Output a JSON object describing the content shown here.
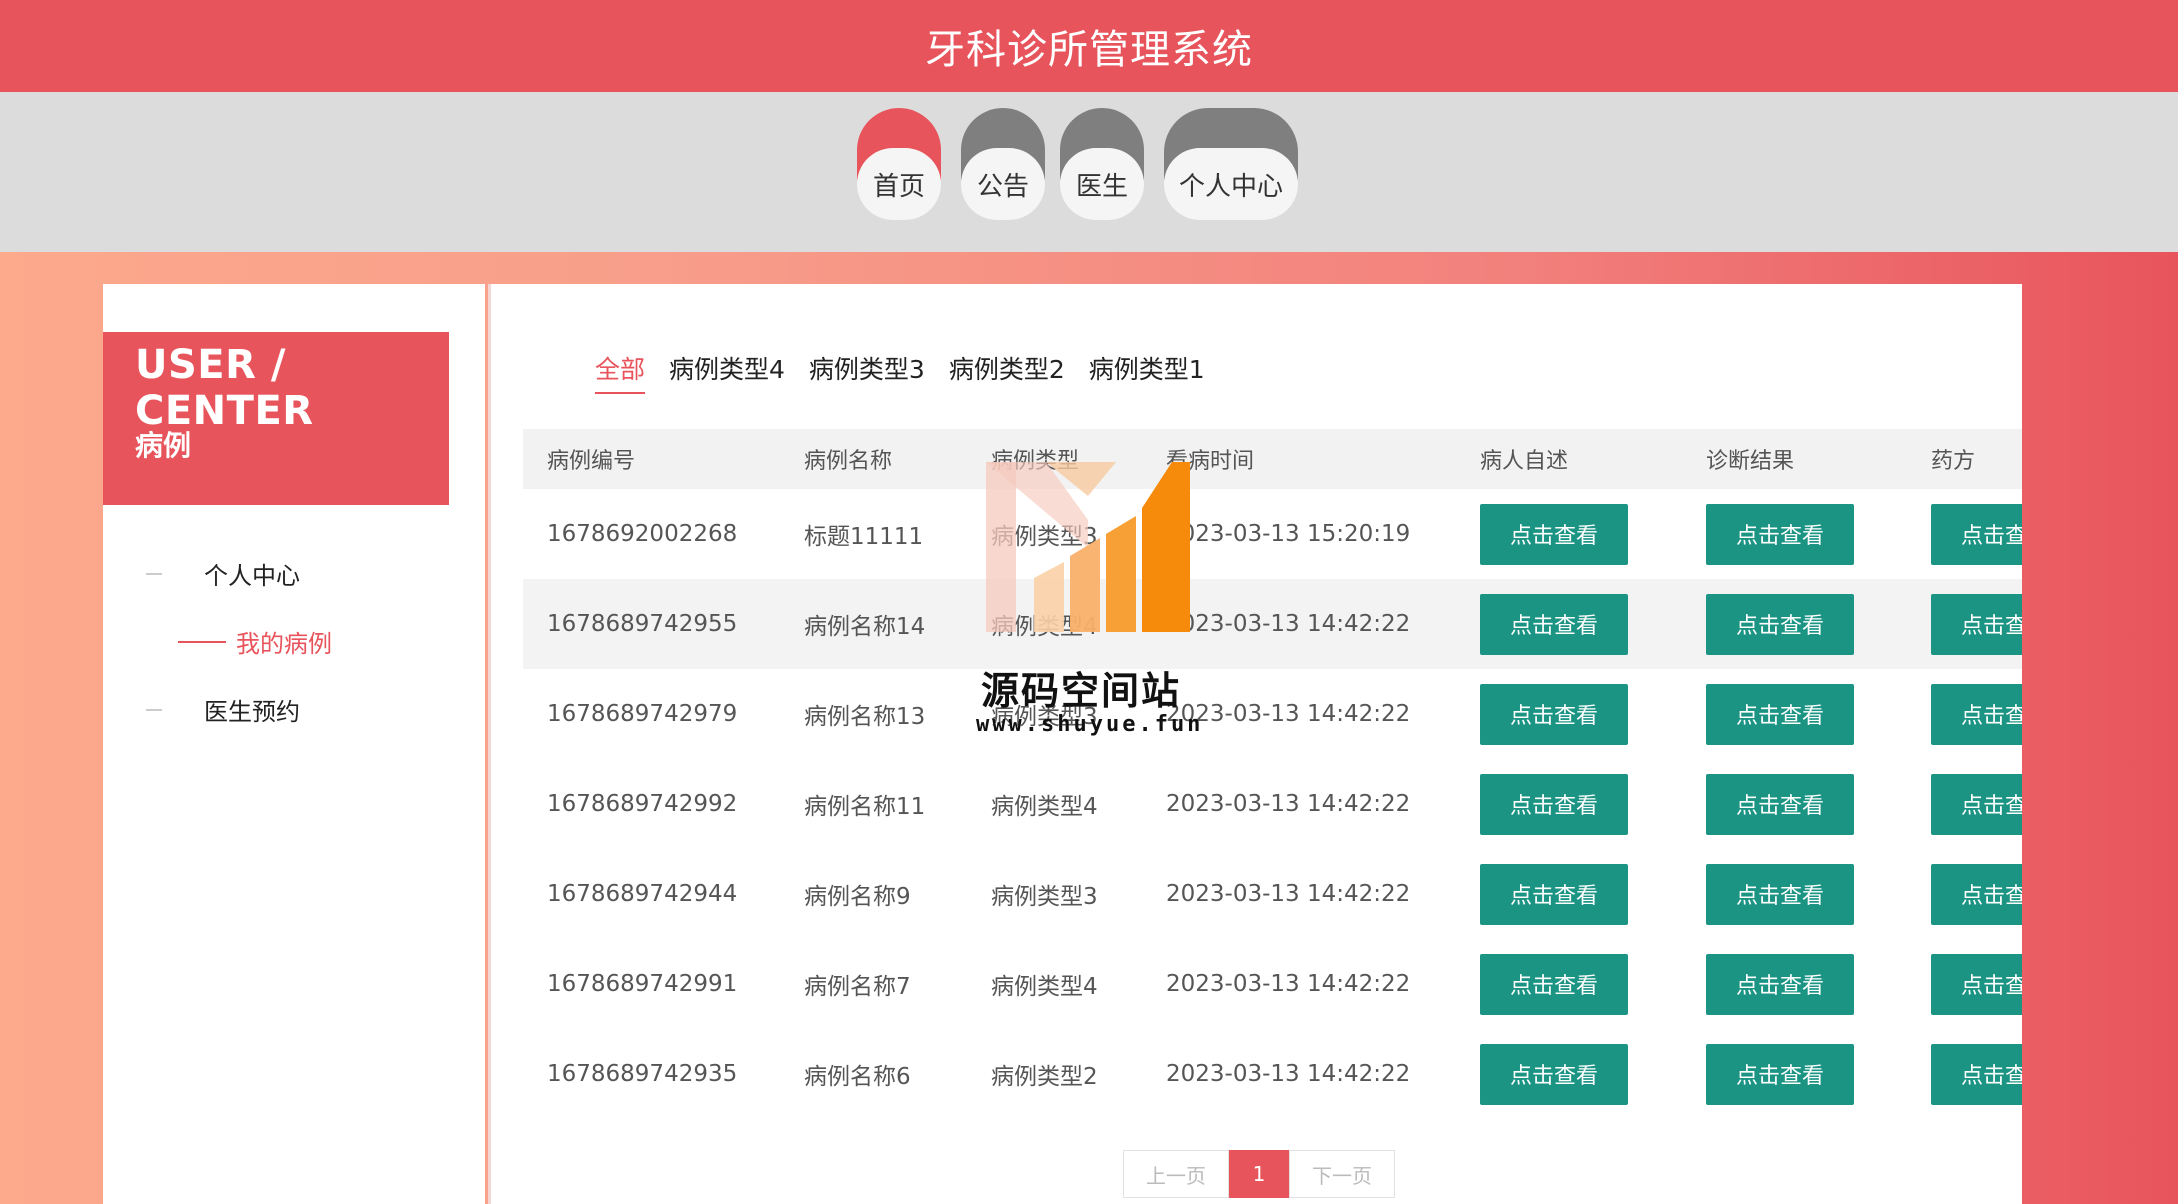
{
  "app": {
    "title": "牙科诊所管理系统"
  },
  "nav": [
    {
      "label": "首页",
      "active": true
    },
    {
      "label": "公告",
      "active": false
    },
    {
      "label": "医生",
      "active": false
    },
    {
      "label": "个人中心",
      "active": false
    }
  ],
  "user_center": {
    "en": "USER / CENTER",
    "zh": "病例"
  },
  "sidebar": {
    "items": [
      {
        "label": "个人中心"
      },
      {
        "label": "我的病例"
      },
      {
        "label": "医生预约"
      }
    ]
  },
  "tabs": [
    {
      "label": "全部",
      "active": true
    },
    {
      "label": "病例类型4"
    },
    {
      "label": "病例类型3"
    },
    {
      "label": "病例类型2"
    },
    {
      "label": "病例类型1"
    }
  ],
  "table": {
    "headers": [
      "病例编号",
      "病例名称",
      "病例类型",
      "看病时间",
      "病人自述",
      "诊断结果",
      "药方"
    ],
    "button_label": "点击查看",
    "rows": [
      {
        "id": "1678692002268",
        "name": "标题11111",
        "type": "病例类型3",
        "time": "2023-03-13 15:20:19"
      },
      {
        "id": "1678689742955",
        "name": "病例名称14",
        "type": "病例类型4",
        "time": "2023-03-13 14:42:22"
      },
      {
        "id": "1678689742979",
        "name": "病例名称13",
        "type": "病例类型3",
        "time": "2023-03-13 14:42:22"
      },
      {
        "id": "1678689742992",
        "name": "病例名称11",
        "type": "病例类型4",
        "time": "2023-03-13 14:42:22"
      },
      {
        "id": "1678689742944",
        "name": "病例名称9",
        "type": "病例类型3",
        "time": "2023-03-13 14:42:22"
      },
      {
        "id": "1678689742991",
        "name": "病例名称7",
        "type": "病例类型4",
        "time": "2023-03-13 14:42:22"
      },
      {
        "id": "1678689742935",
        "name": "病例名称6",
        "type": "病例类型2",
        "time": "2023-03-13 14:42:22"
      }
    ]
  },
  "pager": {
    "prev": "上一页",
    "current": "1",
    "next": "下一页"
  },
  "watermark": {
    "name": "源码空间站",
    "url": "www.shuyue.fun"
  },
  "colors": {
    "primary": "#e8545c",
    "button": "#1b9484",
    "nav_inactive": "#7f7f7f"
  }
}
